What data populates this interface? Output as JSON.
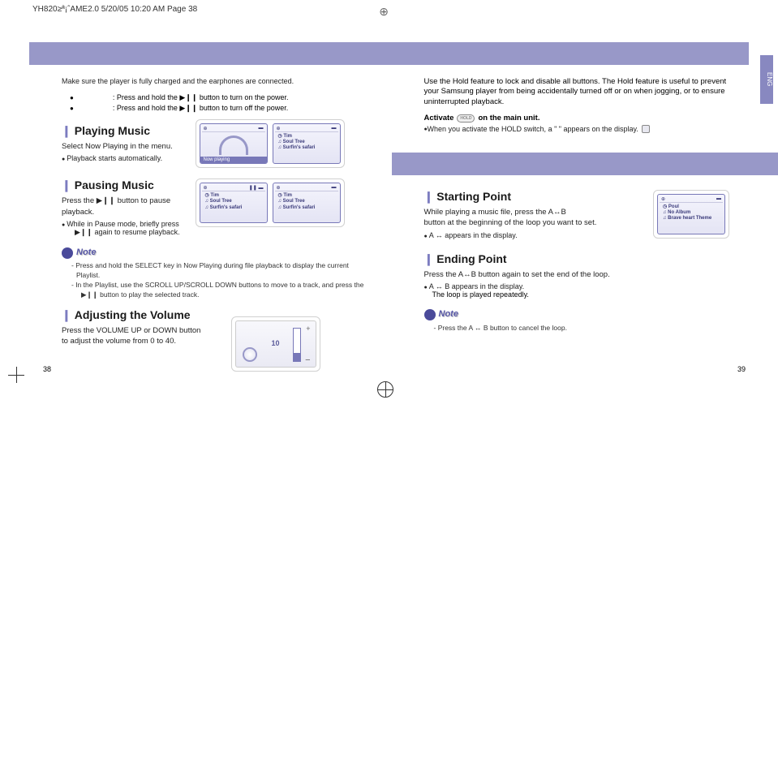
{
  "header": {
    "filename": "YH820≥ª¡ˆAME2.0  5/20/05 10:20 AM  Page 38"
  },
  "lang_tab": "ENG",
  "page_left": "38",
  "page_right": "39",
  "left": {
    "intro": "Make sure the player is fully charged and the earphones are connected.",
    "power_on": ": Press and hold the ▶❙❙ button to turn on the power.",
    "power_off": ": Press and hold the ▶❙❙ button to turn off the power.",
    "playing": {
      "title": "Playing Music",
      "text": "Select Now Playing in the menu.",
      "bullet": "Playback starts automatically."
    },
    "pausing": {
      "title": "Pausing Music",
      "text": "Press the ▶❙❙ button to pause playback.",
      "bullet1": "While in Pause mode, briefly press",
      "bullet2": "▶❙❙ again to resume playback."
    },
    "note1": {
      "label": "Note",
      "line1": "- Press and hold the SELECT key in Now Playing during file playback to display the current Playlist.",
      "line2": "- In the Playlist, use the SCROLL UP/SCROLL DOWN buttons to move to a track, and press the",
      "line3": "▶❙❙ button to play the selected track."
    },
    "volume": {
      "title": "Adjusting the Volume",
      "text": "Press the VOLUME UP or DOWN button to adjust the volume from 0 to 40.",
      "value": "10"
    },
    "screen_track": {
      "artist": "Tim",
      "album": "Soul Tree",
      "song": "Surfin's safari",
      "now_playing": "Now playing"
    }
  },
  "right": {
    "hold_desc": "Use the Hold feature to lock and disable all buttons. The Hold feature is useful to prevent your Samsung player from being accidentally turned off or on when jogging, or to ensure uninterrupted playback.",
    "activate": "Activate",
    "activate_rest": "on the main unit.",
    "activate_bullet": "When you activate the HOLD switch, a \"        \" appears on the display.",
    "starting": {
      "title": "Starting Point",
      "text1": "While playing a music file, press the A↔B",
      "text2": "button at the beginning of the loop you want to set.",
      "bullet": "A ↔ appears in the display."
    },
    "ending": {
      "title": "Ending Point",
      "text": "Press the A↔B button again to set the end of the loop.",
      "bullet1": "A ↔ B appears in the display.",
      "bullet2": "The loop is played repeatedly."
    },
    "note2": {
      "label": "Note",
      "line": "- Press the A ↔ B button to cancel the loop."
    },
    "loop_screen": {
      "artist": "Poul",
      "album": "No Album",
      "song": "Brave heart Theme"
    }
  }
}
